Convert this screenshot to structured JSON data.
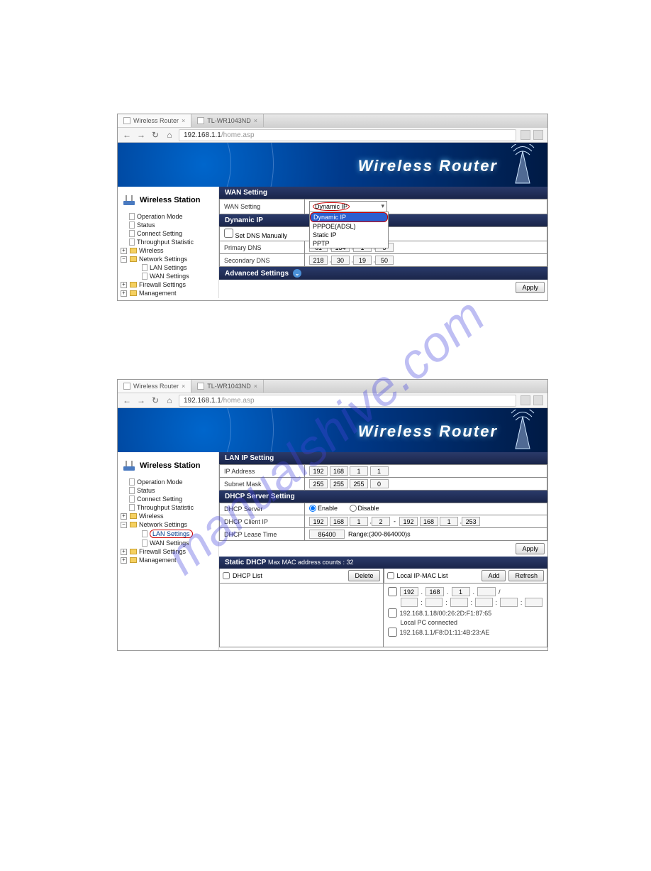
{
  "watermark": "manualshive.com",
  "tabs": {
    "tab1": "Wireless Router",
    "tab2": "TL-WR1043ND"
  },
  "url": {
    "host": "192.168.1.1",
    "path": "/home.asp"
  },
  "banner_title": "Wireless Router",
  "sidebar": {
    "title": "Wireless Station",
    "items": {
      "op_mode": "Operation Mode",
      "status": "Status",
      "connect": "Connect Setting",
      "throughput": "Throughput Statistic",
      "wireless": "Wireless",
      "network": "Network Settings",
      "lan": "LAN Settings",
      "wan": "WAN Settings",
      "firewall": "Firewall Settings",
      "management": "Management"
    }
  },
  "s1": {
    "wan_setting_hdr": "WAN Setting",
    "wan_setting_lbl": "WAN Setting",
    "wan_setting_val": "Dynamic IP",
    "dropdown": {
      "dyn": "Dynamic IP",
      "pppoe": "PPPOE(ADSL)",
      "static": "Static IP",
      "pptp": "PPTP"
    },
    "dynamic_ip_hdr": "Dynamic IP",
    "set_dns": "Set DNS Manually",
    "primary_dns": "Primary DNS",
    "pdns": [
      "61",
      "134",
      "1",
      "5"
    ],
    "secondary_dns": "Secondary DNS",
    "sdns": [
      "218",
      "30",
      "19",
      "50"
    ],
    "advanced": "Advanced Settings",
    "apply": "Apply"
  },
  "s2": {
    "lan_hdr": "LAN IP Setting",
    "ip_addr_lbl": "IP Address",
    "ip_addr": [
      "192",
      "168",
      "1",
      "1"
    ],
    "subnet_lbl": "Subnet Mask",
    "subnet": [
      "255",
      "255",
      "255",
      "0"
    ],
    "dhcp_hdr": "DHCP Server Setting",
    "dhcp_server_lbl": "DHCP Server",
    "enable": "Enable",
    "disable": "Disable",
    "dhcp_client_lbl": "DHCP Client IP",
    "client_start": [
      "192",
      "168",
      "1",
      "2"
    ],
    "client_end": [
      "192",
      "168",
      "1",
      "253"
    ],
    "lease_lbl": "DHCP Lease Time",
    "lease_val": "86400",
    "lease_range": "Range:(300-864000)s",
    "apply": "Apply",
    "static_hdr": "Static DHCP",
    "static_sub": "Max MAC address counts : 32",
    "dhcp_list": "DHCP List",
    "delete": "Delete",
    "local_list": "Local IP-MAC List",
    "add": "Add",
    "refresh": "Refresh",
    "ip_entry": [
      "192",
      "168",
      "1",
      ""
    ],
    "mac1": "192.168.1.18/00:26:2D:F1:87:65",
    "local_pc": "Local PC connected",
    "mac2": "192.168.1.1/F8:D1:11:4B:23:AE"
  }
}
